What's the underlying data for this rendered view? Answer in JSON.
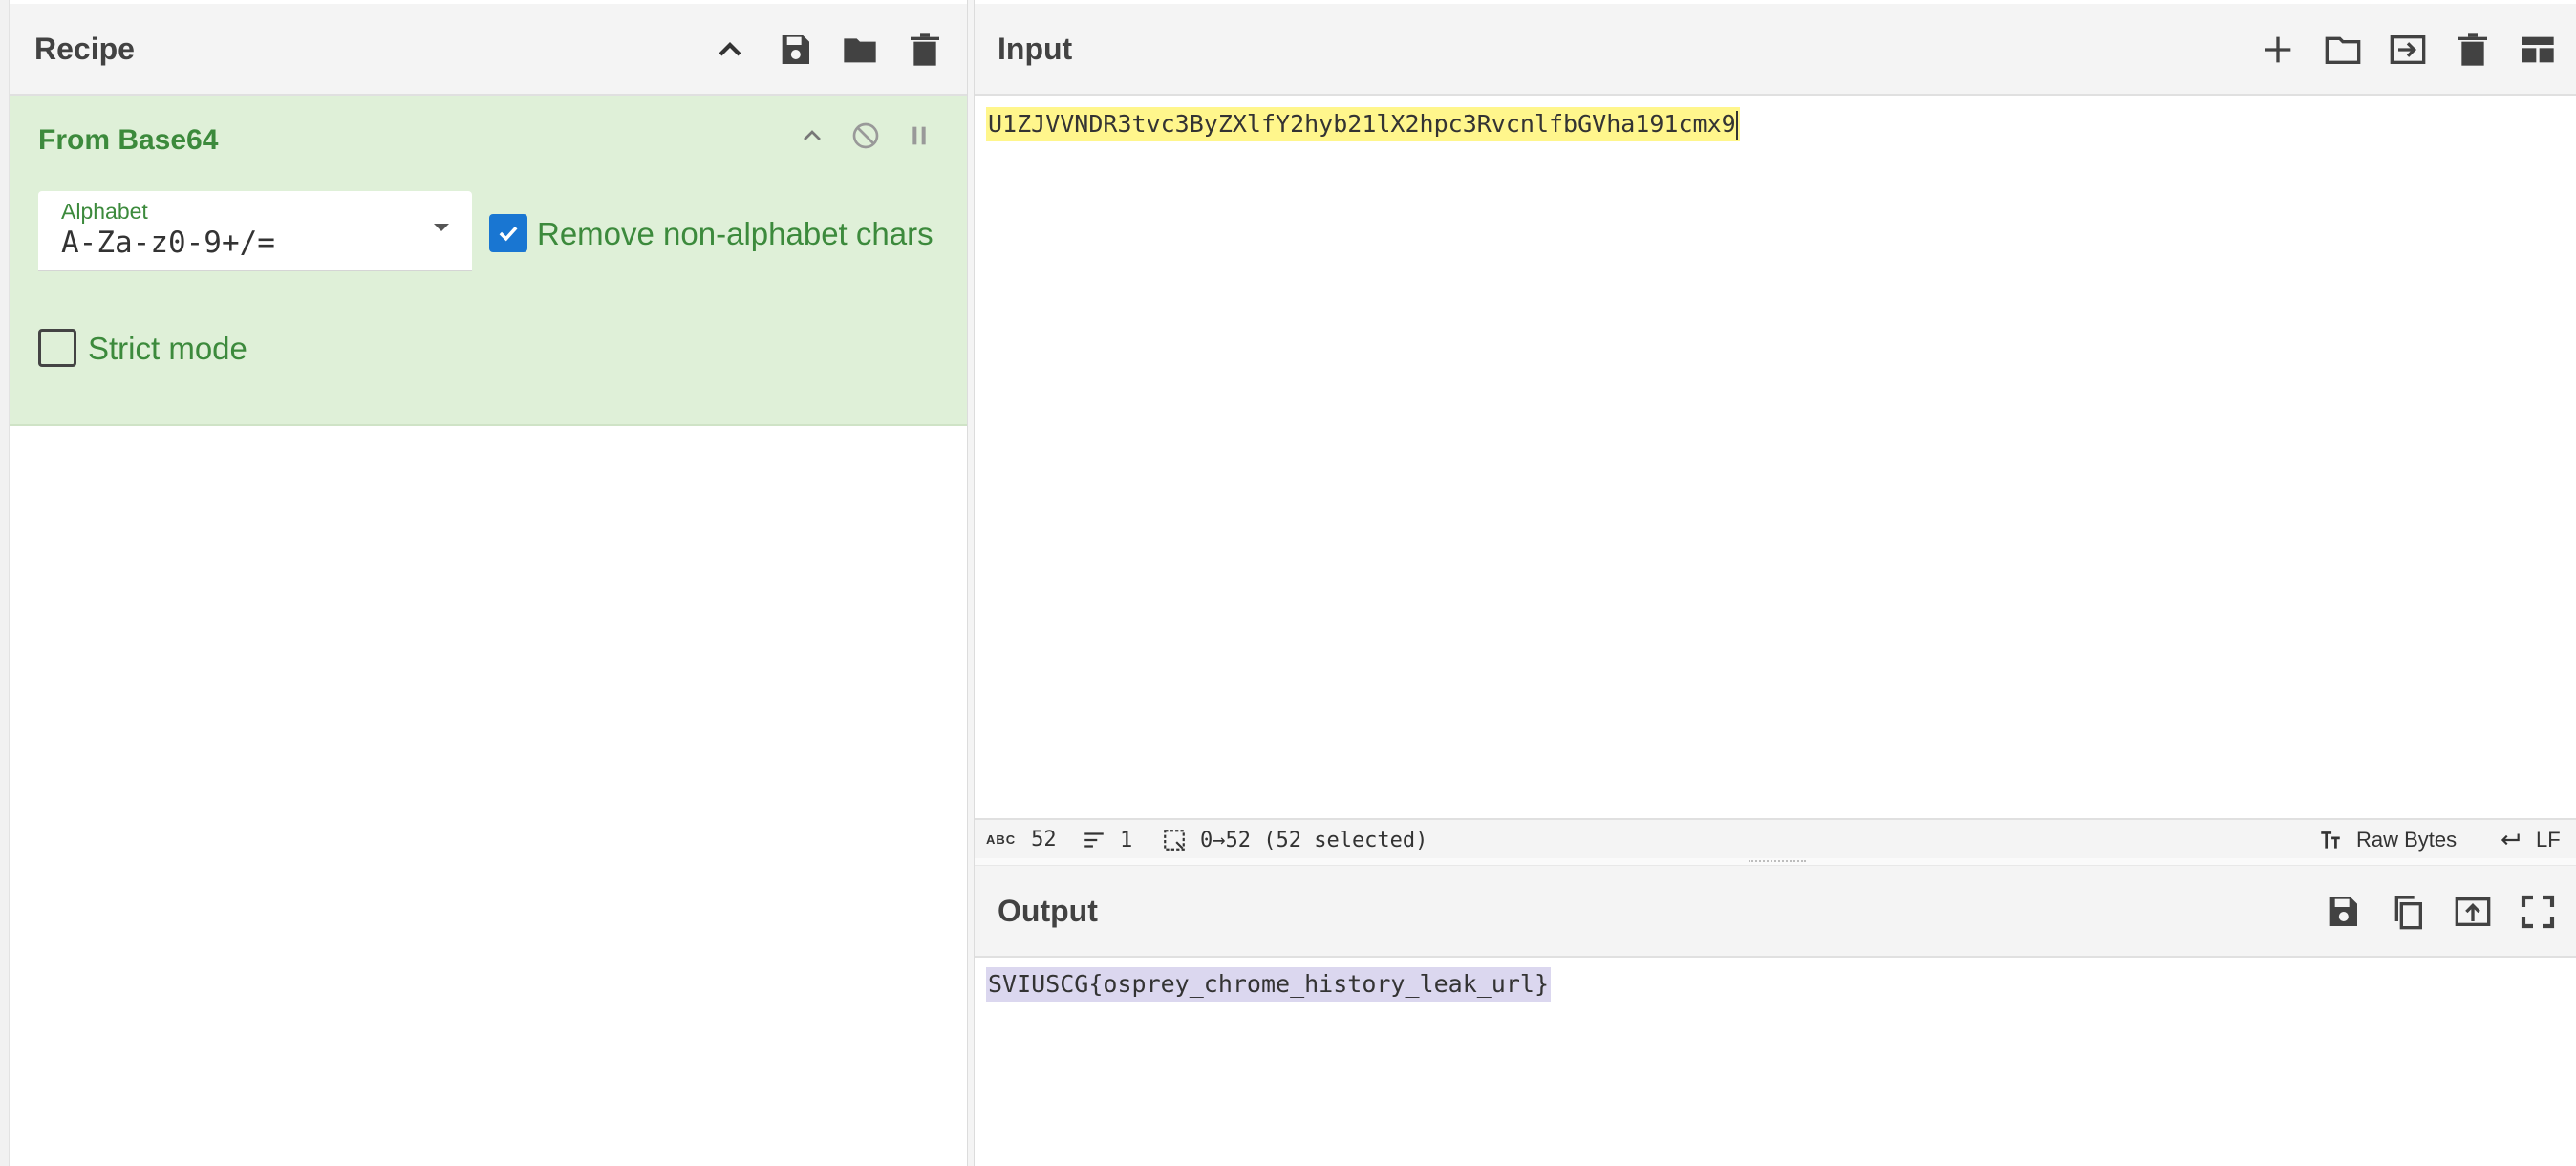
{
  "recipe": {
    "title": "Recipe",
    "icons": [
      "chevron-up-icon",
      "save-icon",
      "folder-icon",
      "trash-icon"
    ]
  },
  "operation": {
    "name": "From Base64",
    "alphabet_label": "Alphabet",
    "alphabet_value": "A-Za-z0-9+/=",
    "remove_non_alpha_label": "Remove non-alphabet chars",
    "remove_non_alpha_checked": true,
    "strict_mode_label": "Strict mode",
    "strict_mode_checked": false
  },
  "input": {
    "title": "Input",
    "text": "U1ZJVVNDR3tvc3ByZXlfY2hyb21lX2hpc3RvcnlfbGVha191cmx9",
    "icons": [
      "plus-icon",
      "folder-icon",
      "input-to-output-icon",
      "trash-icon",
      "layout-icon"
    ]
  },
  "status_bar": {
    "abc_label": "ABC",
    "length": "52",
    "lines": "1",
    "selection": "0→52 (52 selected)",
    "encoding": "Raw Bytes",
    "eol": "LF"
  },
  "output": {
    "title": "Output",
    "text": "SVIUSCG{osprey_chrome_history_leak_url}",
    "icons": [
      "save-icon",
      "copy-icon",
      "replace-input-icon",
      "fullscreen-icon"
    ]
  },
  "colors": {
    "op_card_bg": "#dff0d8",
    "op_accent": "#3c8a3c",
    "input_highlight": "#fff68c",
    "output_highlight": "#dbd7ef",
    "checkbox_blue": "#1976d2"
  }
}
